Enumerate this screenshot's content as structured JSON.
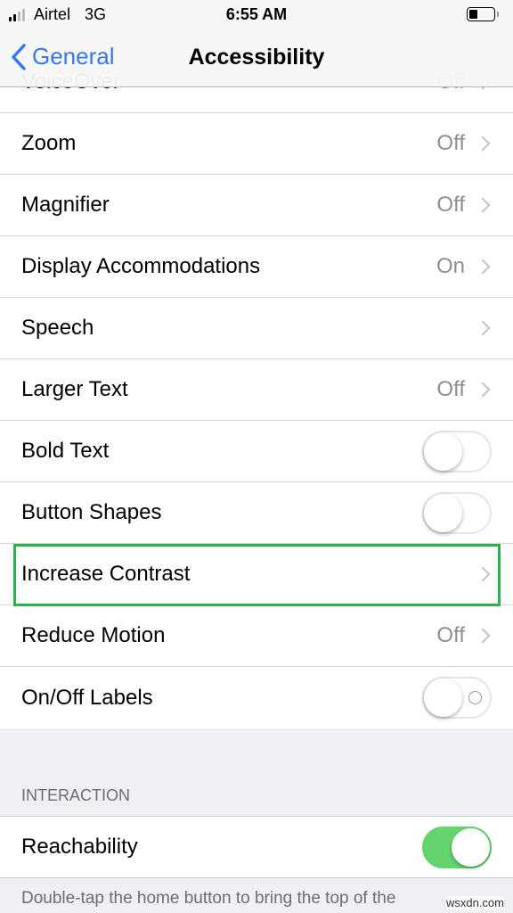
{
  "status_bar": {
    "carrier": "Airtel",
    "network": "3G",
    "time": "6:55 AM",
    "signal_bars": 2,
    "battery_level": 0.3
  },
  "nav": {
    "back_label": "General",
    "title": "Accessibility"
  },
  "partial_row": {
    "label": "VoiceOver",
    "value": "Off"
  },
  "rows": [
    {
      "label": "Zoom",
      "value": "Off",
      "type": "chevron"
    },
    {
      "label": "Magnifier",
      "value": "Off",
      "type": "chevron"
    },
    {
      "label": "Display Accommodations",
      "value": "On",
      "type": "chevron"
    },
    {
      "label": "Speech",
      "value": "",
      "type": "chevron"
    },
    {
      "label": "Larger Text",
      "value": "Off",
      "type": "chevron"
    },
    {
      "label": "Bold Text",
      "type": "toggle",
      "on": false
    },
    {
      "label": "Button Shapes",
      "type": "toggle",
      "on": false
    },
    {
      "label": "Increase Contrast",
      "value": "",
      "type": "chevron",
      "highlighted": true,
      "highlight_color": "#2ab24a"
    },
    {
      "label": "Reduce Motion",
      "value": "Off",
      "type": "chevron"
    },
    {
      "label": "On/Off Labels",
      "type": "toggle",
      "on": false
    }
  ],
  "interaction": {
    "header": "INTERACTION",
    "reachability": {
      "label": "Reachability",
      "on": true
    },
    "footer": "Double-tap the home button to bring the top of the"
  },
  "colors": {
    "accent": "#3478f6",
    "toggle_on": "#65d46e"
  },
  "watermark": "wsxdn.com"
}
